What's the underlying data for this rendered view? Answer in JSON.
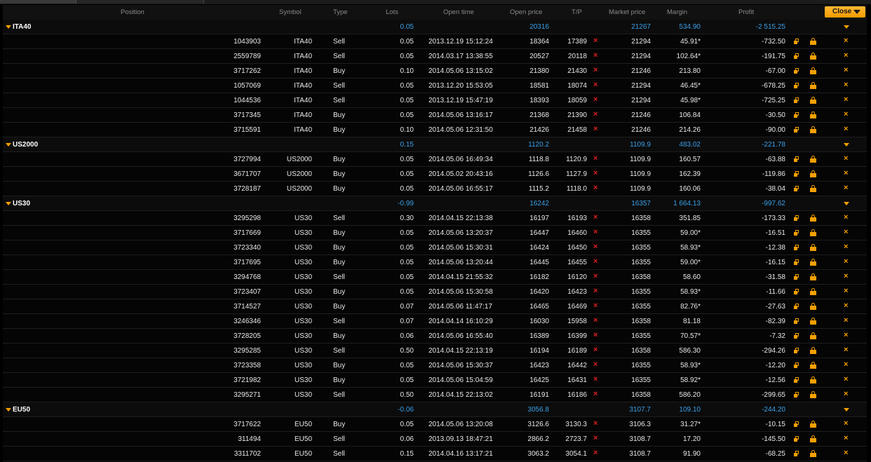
{
  "columns": {
    "position": "Position",
    "symbol": "Symbol",
    "type": "Type",
    "lots": "Lots",
    "open_time": "Open time",
    "open_price": "Open price",
    "tp": "T/P",
    "market_price": "Market price",
    "margin": "Margin",
    "profit": "Profit"
  },
  "close_button": "Close",
  "groups": [
    {
      "name": "ITA40",
      "lots": "0.05",
      "open_price": "20316",
      "market_price": "21267",
      "margin": "534.90",
      "profit": "-2 515.25",
      "rows": [
        {
          "id": "1043903",
          "symbol": "ITA40",
          "type": "Sell",
          "lots": "0.05",
          "time": "2013.12.19 15:12:24",
          "open": "18364",
          "tp": "17389",
          "market": "21294",
          "margin": "45.91*",
          "profit": "-732.50"
        },
        {
          "id": "2559789",
          "symbol": "ITA40",
          "type": "Sell",
          "lots": "0.05",
          "time": "2014.03.17 13:38:55",
          "open": "20527",
          "tp": "20118",
          "market": "21294",
          "margin": "102.64*",
          "profit": "-191.75"
        },
        {
          "id": "3717262",
          "symbol": "ITA40",
          "type": "Buy",
          "lots": "0.10",
          "time": "2014.05.06 13:15:02",
          "open": "21380",
          "tp": "21430",
          "market": "21246",
          "margin": "213.80",
          "profit": "-67.00"
        },
        {
          "id": "1057069",
          "symbol": "ITA40",
          "type": "Sell",
          "lots": "0.05",
          "time": "2013.12.20 15:53:05",
          "open": "18581",
          "tp": "18074",
          "market": "21294",
          "margin": "46.45*",
          "profit": "-678.25"
        },
        {
          "id": "1044536",
          "symbol": "ITA40",
          "type": "Sell",
          "lots": "0.05",
          "time": "2013.12.19 15:47:19",
          "open": "18393",
          "tp": "18059",
          "market": "21294",
          "margin": "45.98*",
          "profit": "-725.25"
        },
        {
          "id": "3717345",
          "symbol": "ITA40",
          "type": "Buy",
          "lots": "0.05",
          "time": "2014.05.06 13:16:17",
          "open": "21368",
          "tp": "21390",
          "market": "21246",
          "margin": "106.84",
          "profit": "-30.50"
        },
        {
          "id": "3715591",
          "symbol": "ITA40",
          "type": "Buy",
          "lots": "0.10",
          "time": "2014.05.06 12:31:50",
          "open": "21426",
          "tp": "21458",
          "market": "21246",
          "margin": "214.26",
          "profit": "-90.00"
        }
      ]
    },
    {
      "name": "US2000",
      "lots": "0.15",
      "open_price": "1120.2",
      "market_price": "1109.9",
      "margin": "483.02",
      "profit": "-221.78",
      "rows": [
        {
          "id": "3727994",
          "symbol": "US2000",
          "type": "Buy",
          "lots": "0.05",
          "time": "2014.05.06 16:49:34",
          "open": "1118.8",
          "tp": "1120.9",
          "market": "1109.9",
          "margin": "160.57",
          "profit": "-63.88"
        },
        {
          "id": "3671707",
          "symbol": "US2000",
          "type": "Buy",
          "lots": "0.05",
          "time": "2014.05.02 20:43:16",
          "open": "1126.6",
          "tp": "1127.9",
          "market": "1109.9",
          "margin": "162.39",
          "profit": "-119.86"
        },
        {
          "id": "3728187",
          "symbol": "US2000",
          "type": "Buy",
          "lots": "0.05",
          "time": "2014.05.06 16:55:17",
          "open": "1115.2",
          "tp": "1118.0",
          "market": "1109.9",
          "margin": "160.06",
          "profit": "-38.04"
        }
      ]
    },
    {
      "name": "US30",
      "lots": "-0.99",
      "open_price": "16242",
      "market_price": "16357",
      "margin": "1 664.13",
      "profit": "-997.62",
      "rows": [
        {
          "id": "3295298",
          "symbol": "US30",
          "type": "Sell",
          "lots": "0.30",
          "time": "2014.04.15 22:13:38",
          "open": "16197",
          "tp": "16193",
          "market": "16358",
          "margin": "351.85",
          "profit": "-173.33"
        },
        {
          "id": "3717669",
          "symbol": "US30",
          "type": "Buy",
          "lots": "0.05",
          "time": "2014.05.06 13:20:37",
          "open": "16447",
          "tp": "16460",
          "market": "16355",
          "margin": "59.00*",
          "profit": "-16.51"
        },
        {
          "id": "3723340",
          "symbol": "US30",
          "type": "Buy",
          "lots": "0.05",
          "time": "2014.05.06 15:30:31",
          "open": "16424",
          "tp": "16450",
          "market": "16355",
          "margin": "58.93*",
          "profit": "-12.38"
        },
        {
          "id": "3717695",
          "symbol": "US30",
          "type": "Buy",
          "lots": "0.05",
          "time": "2014.05.06 13:20:44",
          "open": "16445",
          "tp": "16455",
          "market": "16355",
          "margin": "59.00*",
          "profit": "-16.15"
        },
        {
          "id": "3294768",
          "symbol": "US30",
          "type": "Sell",
          "lots": "0.05",
          "time": "2014.04.15 21:55:32",
          "open": "16182",
          "tp": "16120",
          "market": "16358",
          "margin": "58.60",
          "profit": "-31.58"
        },
        {
          "id": "3723407",
          "symbol": "US30",
          "type": "Buy",
          "lots": "0.05",
          "time": "2014.05.06 15:30:58",
          "open": "16420",
          "tp": "16423",
          "market": "16355",
          "margin": "58.93*",
          "profit": "-11.66"
        },
        {
          "id": "3714527",
          "symbol": "US30",
          "type": "Buy",
          "lots": "0.07",
          "time": "2014.05.06 11:47:17",
          "open": "16465",
          "tp": "16469",
          "market": "16355",
          "margin": "82.76*",
          "profit": "-27.63"
        },
        {
          "id": "3246346",
          "symbol": "US30",
          "type": "Sell",
          "lots": "0.07",
          "time": "2014.04.14 16:10:29",
          "open": "16030",
          "tp": "15958",
          "market": "16358",
          "margin": "81.18",
          "profit": "-82.39"
        },
        {
          "id": "3728205",
          "symbol": "US30",
          "type": "Buy",
          "lots": "0.06",
          "time": "2014.05.06 16:55:40",
          "open": "16389",
          "tp": "16399",
          "market": "16355",
          "margin": "70.57*",
          "profit": "-7.32"
        },
        {
          "id": "3295285",
          "symbol": "US30",
          "type": "Sell",
          "lots": "0.50",
          "time": "2014.04.15 22:13:19",
          "open": "16194",
          "tp": "16189",
          "market": "16358",
          "margin": "586.30",
          "profit": "-294.26"
        },
        {
          "id": "3723358",
          "symbol": "US30",
          "type": "Buy",
          "lots": "0.05",
          "time": "2014.05.06 15:30:37",
          "open": "16423",
          "tp": "16442",
          "market": "16355",
          "margin": "58.93*",
          "profit": "-12.20"
        },
        {
          "id": "3721982",
          "symbol": "US30",
          "type": "Buy",
          "lots": "0.05",
          "time": "2014.05.06 15:04:59",
          "open": "16425",
          "tp": "16431",
          "market": "16355",
          "margin": "58.92*",
          "profit": "-12.56"
        },
        {
          "id": "3295271",
          "symbol": "US30",
          "type": "Sell",
          "lots": "0.50",
          "time": "2014.04.15 22:13:02",
          "open": "16191",
          "tp": "16186",
          "market": "16358",
          "margin": "586.20",
          "profit": "-299.65"
        }
      ]
    },
    {
      "name": "EU50",
      "lots": "-0.06",
      "open_price": "3056.8",
      "market_price": "3107.7",
      "margin": "109.10",
      "profit": "-244.20",
      "rows": [
        {
          "id": "3717622",
          "symbol": "EU50",
          "type": "Buy",
          "lots": "0.05",
          "time": "2014.05.06 13:20:08",
          "open": "3126.6",
          "tp": "3130.3",
          "market": "3106.3",
          "margin": "31.27*",
          "profit": "-10.15"
        },
        {
          "id": "311494",
          "symbol": "EU50",
          "type": "Sell",
          "lots": "0.06",
          "time": "2013.09.13 18:47:21",
          "open": "2866.2",
          "tp": "2723.7",
          "market": "3108.7",
          "margin": "17.20",
          "profit": "-145.50"
        },
        {
          "id": "3311702",
          "symbol": "EU50",
          "type": "Sell",
          "lots": "0.15",
          "time": "2014.04.16 13:17:21",
          "open": "3063.2",
          "tp": "3054.1",
          "market": "3108.7",
          "margin": "91.90",
          "profit": "-68.25"
        }
      ]
    }
  ],
  "icons": {
    "expand": "chevron-down-icon",
    "remove_tp": "remove-tp-icon",
    "modify": "modify-order-icon",
    "lock": "lock-icon",
    "close_position": "close-position-icon"
  },
  "colors": {
    "accent": "#f5a000",
    "summary": "#3aa0e8",
    "remove": "#e02020"
  }
}
